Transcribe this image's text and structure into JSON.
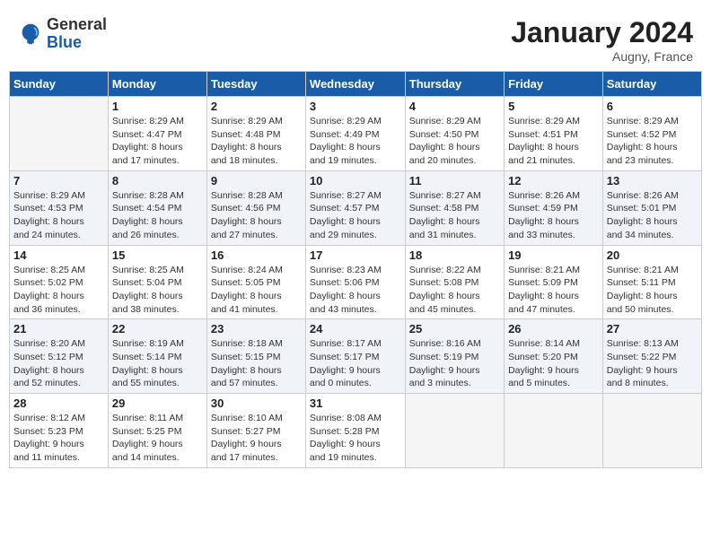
{
  "header": {
    "logo_general": "General",
    "logo_blue": "Blue",
    "month_title": "January 2024",
    "location": "Augny, France"
  },
  "weekdays": [
    "Sunday",
    "Monday",
    "Tuesday",
    "Wednesday",
    "Thursday",
    "Friday",
    "Saturday"
  ],
  "weeks": [
    [
      {
        "day": "",
        "info": ""
      },
      {
        "day": "1",
        "info": "Sunrise: 8:29 AM\nSunset: 4:47 PM\nDaylight: 8 hours\nand 17 minutes."
      },
      {
        "day": "2",
        "info": "Sunrise: 8:29 AM\nSunset: 4:48 PM\nDaylight: 8 hours\nand 18 minutes."
      },
      {
        "day": "3",
        "info": "Sunrise: 8:29 AM\nSunset: 4:49 PM\nDaylight: 8 hours\nand 19 minutes."
      },
      {
        "day": "4",
        "info": "Sunrise: 8:29 AM\nSunset: 4:50 PM\nDaylight: 8 hours\nand 20 minutes."
      },
      {
        "day": "5",
        "info": "Sunrise: 8:29 AM\nSunset: 4:51 PM\nDaylight: 8 hours\nand 21 minutes."
      },
      {
        "day": "6",
        "info": "Sunrise: 8:29 AM\nSunset: 4:52 PM\nDaylight: 8 hours\nand 23 minutes."
      }
    ],
    [
      {
        "day": "7",
        "info": "Sunrise: 8:29 AM\nSunset: 4:53 PM\nDaylight: 8 hours\nand 24 minutes."
      },
      {
        "day": "8",
        "info": "Sunrise: 8:28 AM\nSunset: 4:54 PM\nDaylight: 8 hours\nand 26 minutes."
      },
      {
        "day": "9",
        "info": "Sunrise: 8:28 AM\nSunset: 4:56 PM\nDaylight: 8 hours\nand 27 minutes."
      },
      {
        "day": "10",
        "info": "Sunrise: 8:27 AM\nSunset: 4:57 PM\nDaylight: 8 hours\nand 29 minutes."
      },
      {
        "day": "11",
        "info": "Sunrise: 8:27 AM\nSunset: 4:58 PM\nDaylight: 8 hours\nand 31 minutes."
      },
      {
        "day": "12",
        "info": "Sunrise: 8:26 AM\nSunset: 4:59 PM\nDaylight: 8 hours\nand 33 minutes."
      },
      {
        "day": "13",
        "info": "Sunrise: 8:26 AM\nSunset: 5:01 PM\nDaylight: 8 hours\nand 34 minutes."
      }
    ],
    [
      {
        "day": "14",
        "info": "Sunrise: 8:25 AM\nSunset: 5:02 PM\nDaylight: 8 hours\nand 36 minutes."
      },
      {
        "day": "15",
        "info": "Sunrise: 8:25 AM\nSunset: 5:04 PM\nDaylight: 8 hours\nand 38 minutes."
      },
      {
        "day": "16",
        "info": "Sunrise: 8:24 AM\nSunset: 5:05 PM\nDaylight: 8 hours\nand 41 minutes."
      },
      {
        "day": "17",
        "info": "Sunrise: 8:23 AM\nSunset: 5:06 PM\nDaylight: 8 hours\nand 43 minutes."
      },
      {
        "day": "18",
        "info": "Sunrise: 8:22 AM\nSunset: 5:08 PM\nDaylight: 8 hours\nand 45 minutes."
      },
      {
        "day": "19",
        "info": "Sunrise: 8:21 AM\nSunset: 5:09 PM\nDaylight: 8 hours\nand 47 minutes."
      },
      {
        "day": "20",
        "info": "Sunrise: 8:21 AM\nSunset: 5:11 PM\nDaylight: 8 hours\nand 50 minutes."
      }
    ],
    [
      {
        "day": "21",
        "info": "Sunrise: 8:20 AM\nSunset: 5:12 PM\nDaylight: 8 hours\nand 52 minutes."
      },
      {
        "day": "22",
        "info": "Sunrise: 8:19 AM\nSunset: 5:14 PM\nDaylight: 8 hours\nand 55 minutes."
      },
      {
        "day": "23",
        "info": "Sunrise: 8:18 AM\nSunset: 5:15 PM\nDaylight: 8 hours\nand 57 minutes."
      },
      {
        "day": "24",
        "info": "Sunrise: 8:17 AM\nSunset: 5:17 PM\nDaylight: 9 hours\nand 0 minutes."
      },
      {
        "day": "25",
        "info": "Sunrise: 8:16 AM\nSunset: 5:19 PM\nDaylight: 9 hours\nand 3 minutes."
      },
      {
        "day": "26",
        "info": "Sunrise: 8:14 AM\nSunset: 5:20 PM\nDaylight: 9 hours\nand 5 minutes."
      },
      {
        "day": "27",
        "info": "Sunrise: 8:13 AM\nSunset: 5:22 PM\nDaylight: 9 hours\nand 8 minutes."
      }
    ],
    [
      {
        "day": "28",
        "info": "Sunrise: 8:12 AM\nSunset: 5:23 PM\nDaylight: 9 hours\nand 11 minutes."
      },
      {
        "day": "29",
        "info": "Sunrise: 8:11 AM\nSunset: 5:25 PM\nDaylight: 9 hours\nand 14 minutes."
      },
      {
        "day": "30",
        "info": "Sunrise: 8:10 AM\nSunset: 5:27 PM\nDaylight: 9 hours\nand 17 minutes."
      },
      {
        "day": "31",
        "info": "Sunrise: 8:08 AM\nSunset: 5:28 PM\nDaylight: 9 hours\nand 19 minutes."
      },
      {
        "day": "",
        "info": ""
      },
      {
        "day": "",
        "info": ""
      },
      {
        "day": "",
        "info": ""
      }
    ]
  ]
}
